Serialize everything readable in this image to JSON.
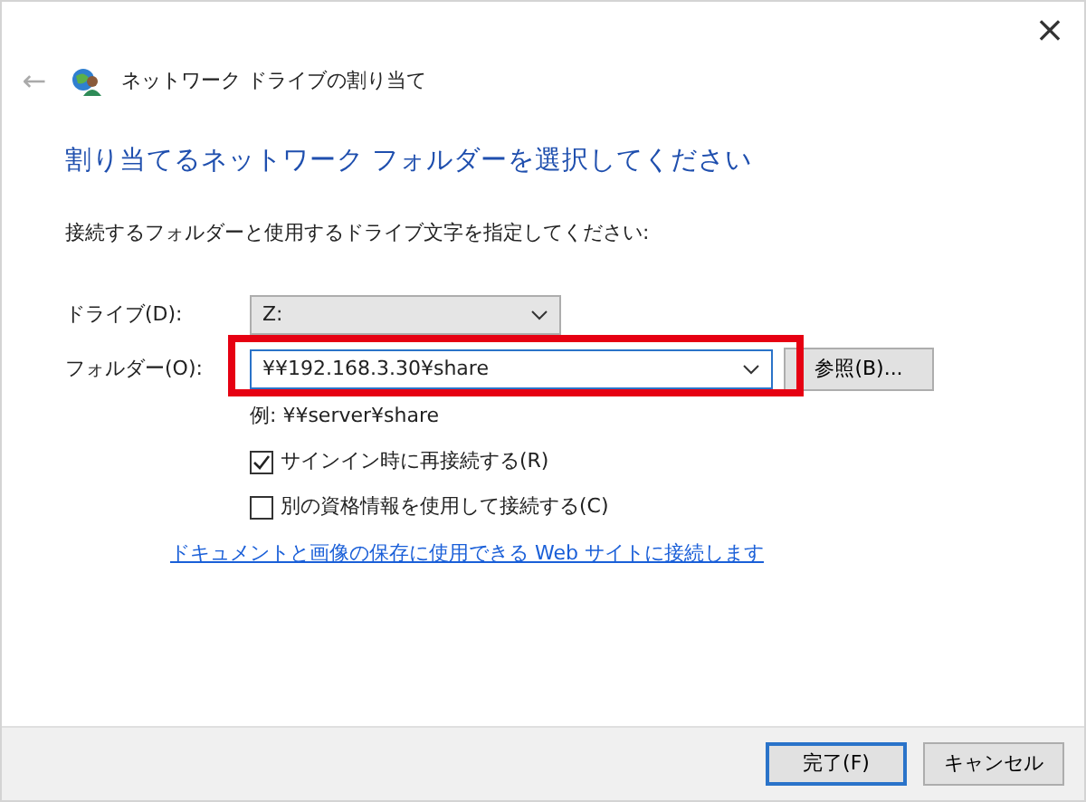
{
  "window": {
    "title": "ネットワーク ドライブの割り当て",
    "close": "×",
    "back": "←"
  },
  "heading": "割り当てるネットワーク フォルダーを選択してください",
  "instruction": "接続するフォルダーと使用するドライブ文字を指定してください:",
  "drive": {
    "label": "ドライブ(D):",
    "value": "Z:"
  },
  "folder": {
    "label": "フォルダー(O):",
    "value": "¥¥192.168.3.30¥share",
    "highlighted": true,
    "browse": "参照(B)..."
  },
  "example": "例: ¥¥server¥share",
  "options": [
    {
      "label": "サインイン時に再接続する(R)",
      "checked": true
    },
    {
      "label": "別の資格情報を使用して接続する(C)",
      "checked": false
    }
  ],
  "link": "ドキュメントと画像の保存に使用できる Web サイトに接続します",
  "buttons": [
    {
      "label": "完了(F)",
      "default": true
    },
    {
      "label": "キャンセル",
      "default": false
    }
  ]
}
